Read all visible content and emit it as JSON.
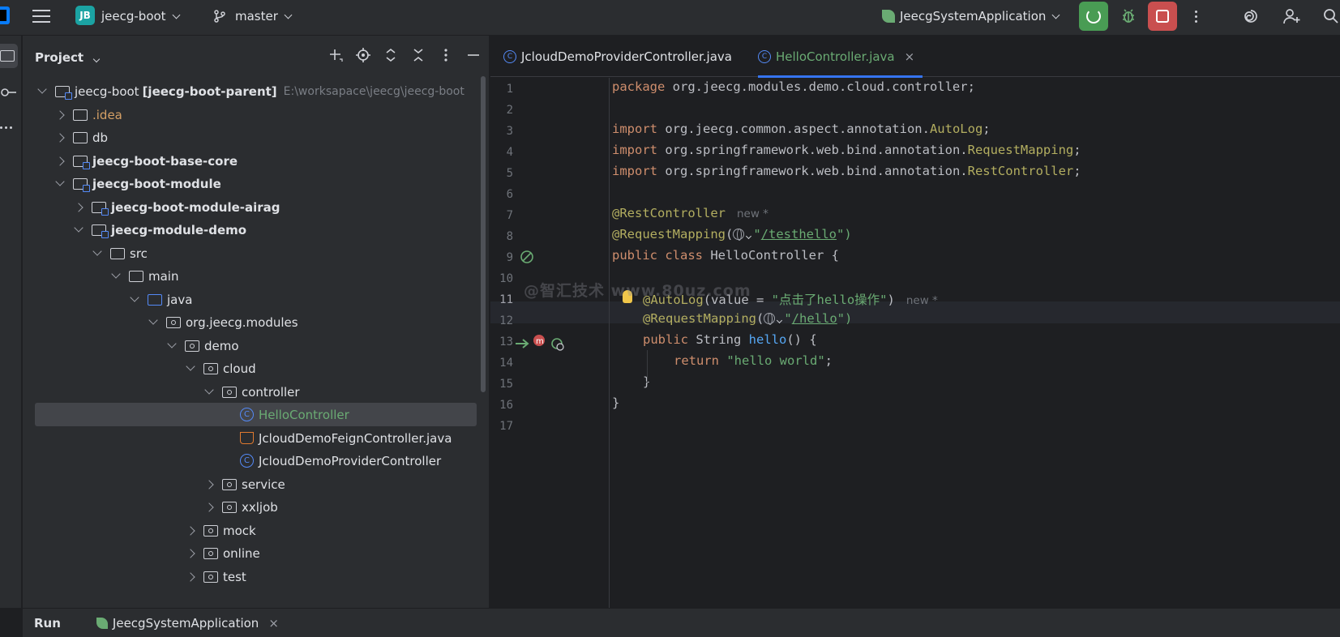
{
  "topbar": {
    "project_badge": "JB",
    "project_name": "jeecg-boot",
    "branch": "master",
    "run_config": "JeecgSystemApplication"
  },
  "project_panel": {
    "title": "Project",
    "tree": [
      {
        "label": "jeecg-boot",
        "extra_bold": "[jeecg-boot-parent]",
        "path": "E:\\worksapace\\jeecg\\jeecg-boot"
      },
      {
        "label": ".idea"
      },
      {
        "label": "db"
      },
      {
        "label": "jeecg-boot-base-core"
      },
      {
        "label": "jeecg-boot-module"
      },
      {
        "label": "jeecg-boot-module-airag"
      },
      {
        "label": "jeecg-module-demo"
      },
      {
        "label": "src"
      },
      {
        "label": "main"
      },
      {
        "label": "java"
      },
      {
        "label": "org.jeecg.modules"
      },
      {
        "label": "demo"
      },
      {
        "label": "cloud"
      },
      {
        "label": "controller"
      },
      {
        "label": "HelloController"
      },
      {
        "label": "JcloudDemoFeignController.java"
      },
      {
        "label": "JcloudDemoProviderController"
      },
      {
        "label": "service"
      },
      {
        "label": "xxljob"
      },
      {
        "label": "mock"
      },
      {
        "label": "online"
      },
      {
        "label": "test"
      }
    ]
  },
  "editor": {
    "tabs": [
      {
        "label": "JcloudDemoProviderController.java"
      },
      {
        "label": "HelloController.java"
      }
    ],
    "close_glyph": "×",
    "line_numbers": [
      "1",
      "2",
      "3",
      "4",
      "5",
      "6",
      "7",
      "8",
      "9",
      "10",
      "11",
      "12",
      "13",
      "14",
      "15",
      "16",
      "17"
    ],
    "code": {
      "l1_kw": "package",
      "l1_rest": " org.jeecg.modules.demo.cloud.controller;",
      "imp_kw": "import",
      "l3_pkg": " org.jeecg.common.aspect.annotation.",
      "l3_cls": "AutoLog",
      "l4_pkg": " org.springframework.web.bind.annotation.",
      "l4_cls": "RequestMapping",
      "l5_pkg": " org.springframework.web.bind.annotation.",
      "l5_cls": "RestController",
      "semi": ";",
      "l7_ann": "@RestController",
      "hint_new": "new *",
      "l8_ann": "@RequestMapping",
      "paren_open": "(",
      "quote": "\"",
      "l8_url": "/testhello",
      "paren_close_q": "\")",
      "l9_a": "public class",
      "l9_b": " HelloController {",
      "l11_ann": "@AutoLog",
      "l11_mid": "(value = ",
      "l11_str": "\"点击了hello操作\"",
      "l11_end": ")",
      "l12_ann": "@RequestMapping",
      "l12_url": "/hello",
      "l13_kw": "public",
      "l13_type": " String ",
      "l13_fn": "hello",
      "l13_end": "() {",
      "l14_kw": "return",
      "l14_str": " \"hello world\"",
      "l15": "}",
      "l16": "}"
    },
    "watermark": "@智汇技术 www.80uz.com"
  },
  "runbar": {
    "title": "Run",
    "tab_label": "JeecgSystemApplication",
    "close_glyph": "×"
  }
}
